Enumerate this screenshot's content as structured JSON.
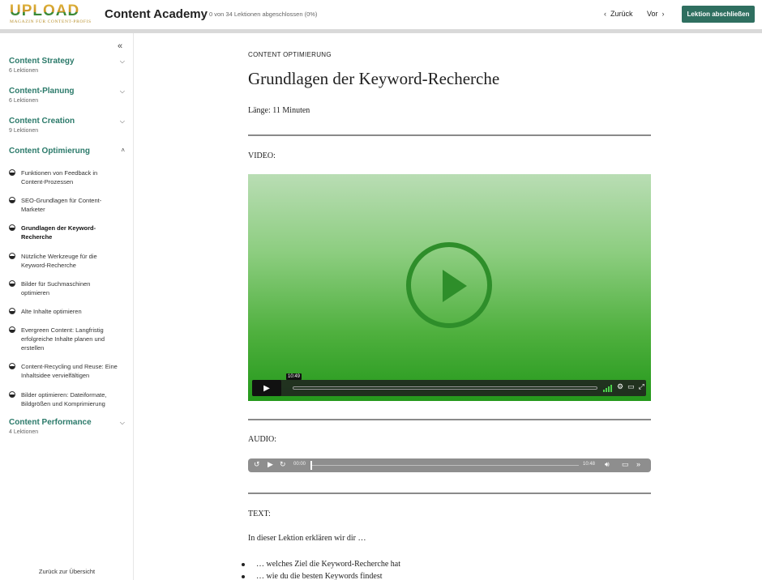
{
  "header": {
    "logo_word": "UPLOAD",
    "logo_sub": "MAGAZIN FÜR CONTENT-PROFIS",
    "title": "Content Academy",
    "progress": "0 von 34 Lektionen abgeschlossen (0%)",
    "back_label": "Zurück",
    "next_label": "Vor",
    "complete_label": "Lektion abschließen"
  },
  "sidebar": {
    "modules": [
      {
        "title": "Content Strategy",
        "sub": "6 Lektionen"
      },
      {
        "title": "Content-Planung",
        "sub": "6 Lektionen"
      },
      {
        "title": "Content Creation",
        "sub": "9 Lektionen"
      },
      {
        "title": "Content Optimierung"
      },
      {
        "title": "Content Performance",
        "sub": "4 Lektionen"
      }
    ],
    "lessons": [
      "Funktionen von Feedback in Content-Prozessen",
      "SEO-Grundlagen für Content-Marketer",
      "Grundlagen der Keyword-Recherche",
      "Nützliche Werkzeuge für die Keyword-Recherche",
      "Bilder für Suchmaschinen optimieren",
      "Alte Inhalte optimieren",
      "Evergreen Content: Langfristig erfolgreiche Inhalte planen und erstellen",
      "Content-Recycling und Reuse: Eine Inhaltsidee vervielfältigen",
      "Bilder optimieren: Dateiformate, Bildgrößen und Komprimierung"
    ],
    "back_overview": "Zurück zur Übersicht"
  },
  "main": {
    "eyebrow": "CONTENT OPTIMIERUNG",
    "title": "Grundlagen der Keyword-Recherche",
    "length": "Länge: 11 Minuten",
    "video_label": "VIDEO:",
    "video_time": "10:49",
    "audio_label": "AUDIO:",
    "audio_current": "00:00",
    "audio_total": "10:48",
    "text_label": "TEXT:",
    "text_intro": "In dieser Lektion erklären wir dir …",
    "bullets": [
      "… welches Ziel die Keyword-Recherche hat",
      "… wie du die besten Keywords findest"
    ]
  },
  "icons": {
    "collapse": "double-chevron-left-icon",
    "chevron_down": "chevron-down-icon",
    "chevron_up": "chevron-up-icon",
    "play": "play-icon",
    "settings": "gear-icon",
    "fullscreen": "fullscreen-icon",
    "volume": "volume-icon"
  },
  "colors": {
    "accent": "#2b7a6a",
    "button": "#2f6f60",
    "video_green": "#2e8e2a"
  }
}
